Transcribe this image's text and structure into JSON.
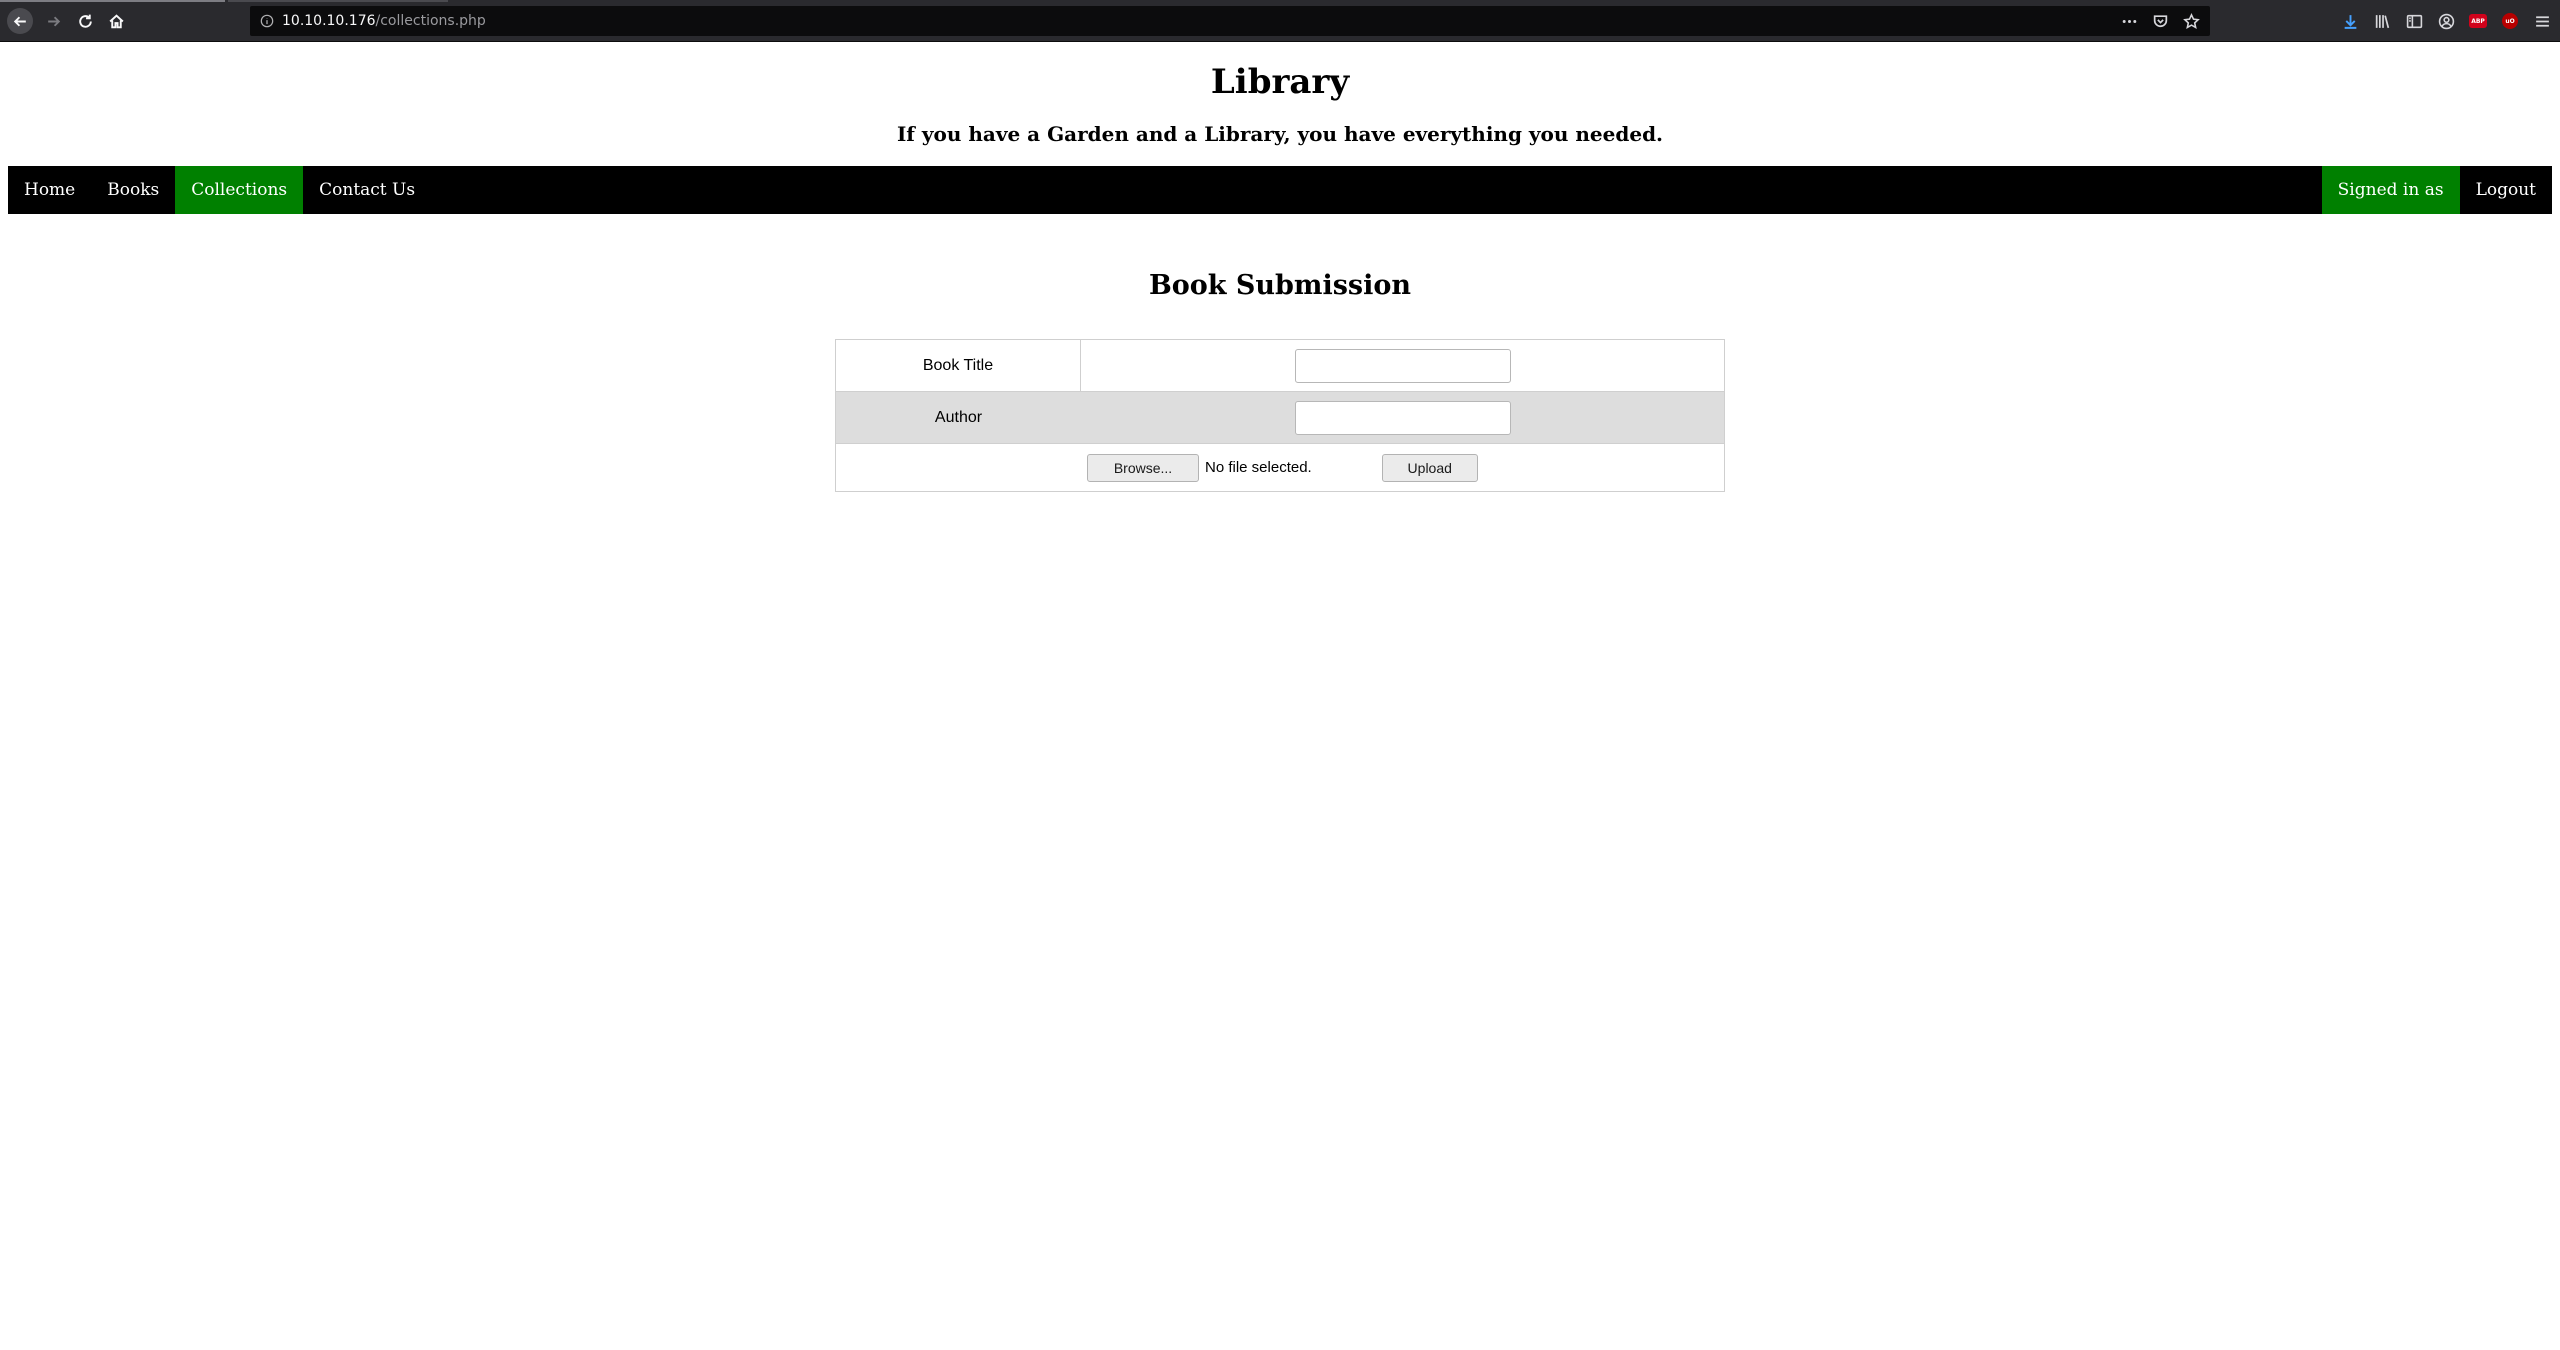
{
  "browser": {
    "url_host": "10.10.10.176",
    "url_path": "/collections.php"
  },
  "site": {
    "title": "Library",
    "tagline": "If you have a Garden and a Library, you have everything you needed."
  },
  "nav": {
    "left": [
      {
        "label": "Home",
        "active": false
      },
      {
        "label": "Books",
        "active": false
      },
      {
        "label": "Collections",
        "active": true
      },
      {
        "label": "Contact Us",
        "active": false
      }
    ],
    "signed_in": "Signed in as",
    "logout": "Logout"
  },
  "form": {
    "heading": "Book Submission",
    "book_title_label": "Book Title",
    "book_title_value": "",
    "author_label": "Author",
    "author_value": "",
    "browse_label": "Browse...",
    "file_status": "No file selected.",
    "upload_label": "Upload"
  },
  "colors": {
    "nav_bg": "#000000",
    "nav_active": "#008000",
    "row_shade": "#dddddd"
  },
  "icons": {
    "ublock_badge": "uO",
    "abp_badge": "ABP"
  }
}
